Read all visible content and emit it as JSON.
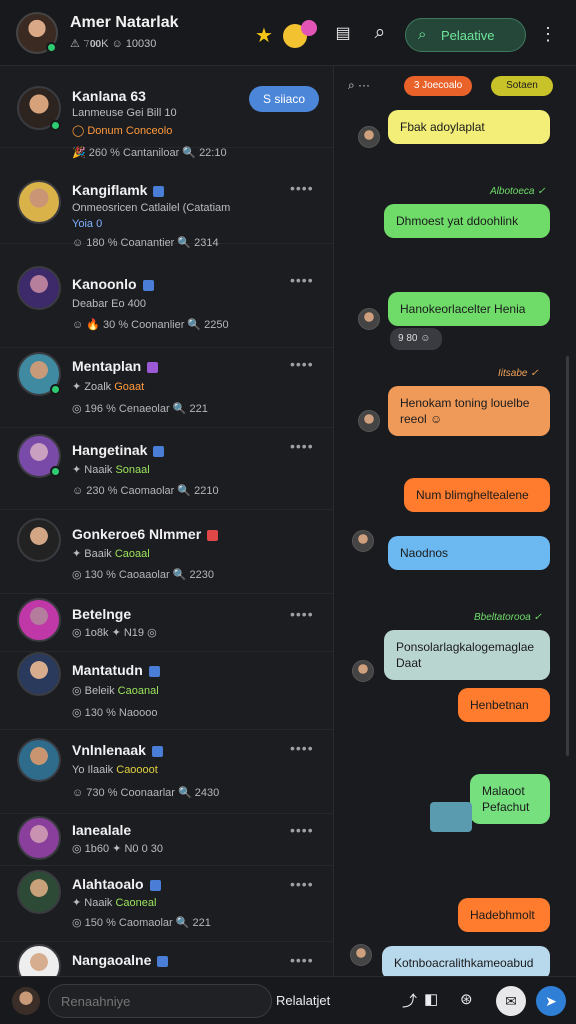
{
  "header": {
    "name": "Amer Natarlak",
    "meta": "⚠ 𝟽𝟬𝟬K  ☺ 10030",
    "search_label": "Pelaative"
  },
  "conversations": [
    {
      "name": "Kanlana 63",
      "line2_plain": "Lanmeuse Gei Bill 10",
      "line2_accent": "",
      "line3": "◯ Donum  Conceolo",
      "line4": "🎉 260 %  Cantaniloar  🔍 22:10",
      "pill": "S siiaco",
      "dots": ""
    },
    {
      "name": "Kangiflamk",
      "line2_plain": "Onmeosricen Catlailel (Catatiam",
      "line2_accent": "",
      "line3": "Yoia 0",
      "line4": "☺ 180 %  Coanantier  🔍 2314",
      "pill": "",
      "dots": "••••"
    },
    {
      "name": "Kanoonlo",
      "line2_plain": "Deabar  Eo 400",
      "line2_accent": "",
      "line3": "",
      "line4": "☺ 🔥 30 %  Coonanlier  🔍 2250",
      "pill": "",
      "dots": "••••"
    },
    {
      "name": "Mentaplan",
      "line2_plain": "✦ Zoalk ",
      "line2_accent": "Goaat ",
      "line3": "",
      "line4": "◎ 196 %  Cenaeolar  🔍 221",
      "pill": "",
      "dots": "••••"
    },
    {
      "name": "Hangetinak",
      "line2_plain": "✦ Naaik ",
      "line2_accent": "Sonaal ",
      "line3": "",
      "line4": "☺ 230 %  Caomaolar  🔍 2210",
      "pill": "",
      "dots": "••••"
    },
    {
      "name": "Gonkeroe6 Nlmmer",
      "line2_plain": "✦ Baaik ",
      "line2_accent": "Caoaal ",
      "line3": "",
      "line4": "◎ 130 %  Caoaaolar  🔍 2230",
      "pill": "",
      "dots": "••••"
    },
    {
      "name": "Betelnge",
      "line2_plain": "◎ 1o8k  ✦ N19  ◎",
      "line2_accent": "",
      "line3": "",
      "line4": "",
      "pill": "",
      "dots": "••••"
    },
    {
      "name": "Mantatudn",
      "line2_plain": "◎ Beleik ",
      "line2_accent": "Caoanal ",
      "line3": "",
      "line4": "◎ 130 %  Naoooo",
      "pill": "",
      "dots": ""
    },
    {
      "name": "Vnlnlenaak",
      "line2_plain": "Yo Ilaaik ",
      "line2_accent": "Caoooot",
      "line3": "",
      "line4": "☺ 730 %  Coonaarlar  🔍 2430",
      "pill": "",
      "dots": "••••"
    },
    {
      "name": "Ianealale",
      "line2_plain": "◎ 1b60  ✦ N0 0 30",
      "line2_accent": "",
      "line3": "",
      "line4": "",
      "pill": "",
      "dots": "••••"
    },
    {
      "name": "Alahtaoalo",
      "line2_plain": "✦ Naaik ",
      "line2_accent": "Caoneal ",
      "line3": "",
      "line4": "◎ 150 %  Caomaolar  🔍 221",
      "pill": "",
      "dots": "••••"
    },
    {
      "name": "Nangaoalne",
      "line2_plain": "",
      "line2_accent": "",
      "line3": "",
      "line4": "",
      "pill": "",
      "dots": "••••"
    }
  ],
  "chat": {
    "chip_orange": "3 Joecoalo",
    "chip_yellow": "Sotaen",
    "messages": [
      {
        "text": "Fbak adoylaplat",
        "color": "#f3ee78"
      },
      {
        "text": "Dhmoest yat ddoohlink",
        "color": "#6fdc6a",
        "stamp": "Albotoeca ✓"
      },
      {
        "text": "Hanokeorlacelter Henia",
        "color": "#6fdc6a",
        "meta": "9 80 ☺"
      },
      {
        "text": "Henokam toning louelbe reeol ☺",
        "color": "#f09a5a",
        "stamp": "Iitsabe ✓"
      },
      {
        "text": "Num blimgheltealene",
        "color": "#ff7c2e"
      },
      {
        "text": "Naodnos",
        "color": "#6cb8f0"
      },
      {
        "text": "Ponsolarlagkalogemaglae Daat",
        "color": "#b9d5d0",
        "stamp": "Bbeltatorooa ✓"
      },
      {
        "text": "Henbetnan",
        "color": "#ff7c2e"
      },
      {
        "text": "Malaoot Pefachut",
        "color": "#76e07e"
      },
      {
        "text": "Hadebhmolt",
        "color": "#ff7c2e"
      },
      {
        "text": "Kotnboacralithkameoabud",
        "color": "#b8d8ec"
      }
    ]
  },
  "composer": {
    "placeholder": "Renaahniye",
    "label": "Relalatjet"
  }
}
